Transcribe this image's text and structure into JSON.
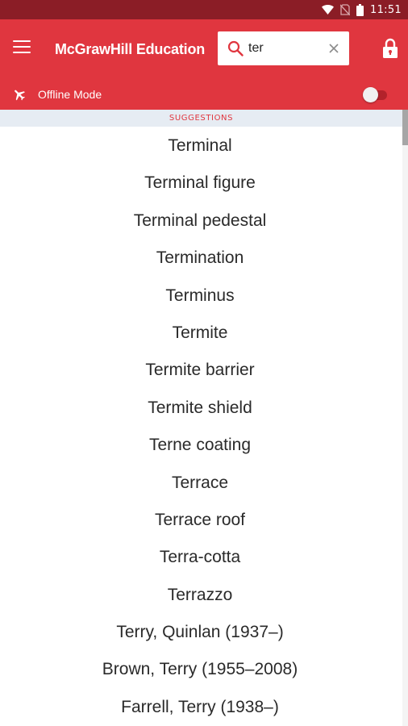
{
  "status_bar": {
    "time": "11:51",
    "icons": [
      "wifi-icon",
      "no-sim-icon",
      "battery-icon"
    ]
  },
  "app_bar": {
    "menu_icon": "hamburger-menu-icon",
    "brand": "McGrawHill Education",
    "search": {
      "value": "ter",
      "placeholder": ""
    },
    "lock_icon": "lock-icon"
  },
  "offline": {
    "icon": "airplane-icon",
    "label": "Offline Mode",
    "enabled": false
  },
  "suggestions": {
    "header": "SUGGESTIONS",
    "items": [
      "Terminal",
      "Terminal figure",
      "Terminal pedestal",
      "Termination",
      "Terminus",
      "Termite",
      "Termite barrier",
      "Termite shield",
      "Terne coating",
      "Terrace",
      "Terrace roof",
      "Terra-cotta",
      "Terrazzo",
      "Terry, Quinlan (1937–)",
      "Brown, Terry (1955–2008)",
      "Farrell, Terry (1938–)"
    ]
  },
  "colors": {
    "status_bar": "#8b1d26",
    "brand_red": "#e0363f",
    "header_bg": "#e6ecf3"
  }
}
